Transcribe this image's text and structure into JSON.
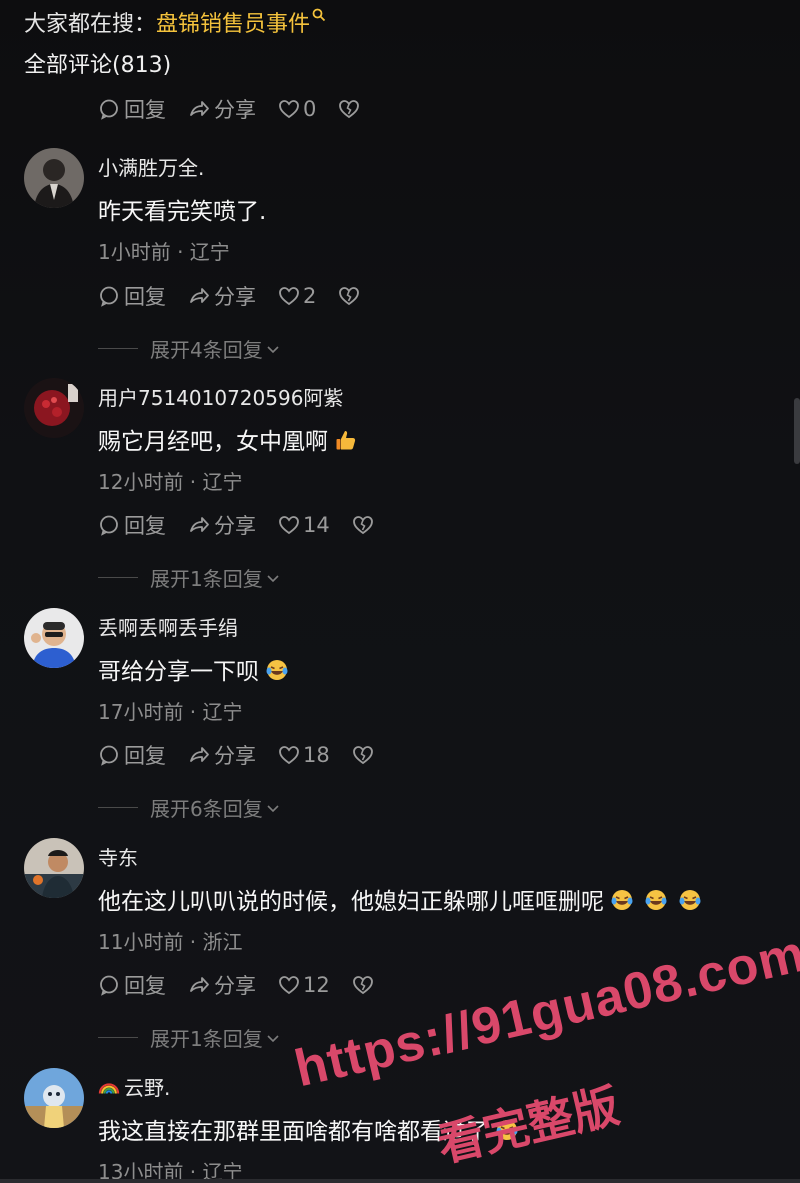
{
  "header": {
    "search_prefix": "大家都在搜：",
    "search_keyword": "盘锦销售员事件",
    "comments_count_label": "全部评论(813)"
  },
  "actions": {
    "reply": "回复",
    "share": "分享"
  },
  "top_actions": {
    "likes": "0"
  },
  "comments": [
    {
      "user": "小满胜万全.",
      "text": "昨天看完笑喷了.",
      "meta": "1小时前 · 辽宁",
      "likes": "2",
      "expand": "展开4条回复"
    },
    {
      "user": "用户7514010720596阿紫",
      "text": "赐它月经吧，女中凰啊",
      "meta": "12小时前 · 辽宁",
      "likes": "14",
      "expand": "展开1条回复"
    },
    {
      "user": "丢啊丢啊丢手绢",
      "text": "哥给分享一下呗",
      "meta": "17小时前 · 辽宁",
      "likes": "18",
      "expand": "展开6条回复"
    },
    {
      "user": "寺东",
      "text": "他在这儿叭叭说的时候，他媳妇正躲哪儿哐哐删呢",
      "meta": "11小时前 · 浙江",
      "likes": "12",
      "expand": "展开1条回复"
    },
    {
      "user": "云野.",
      "text": "我这直接在那群里面啥都有啥都看过了",
      "meta": "13小时前 · 辽宁"
    }
  ],
  "watermark": {
    "url": "https://91gua08.com",
    "caption": "看完整版"
  },
  "colors": {
    "keyword": "#f4c23c",
    "watermark": "#d9486a",
    "muted": "#9b9b9b"
  }
}
